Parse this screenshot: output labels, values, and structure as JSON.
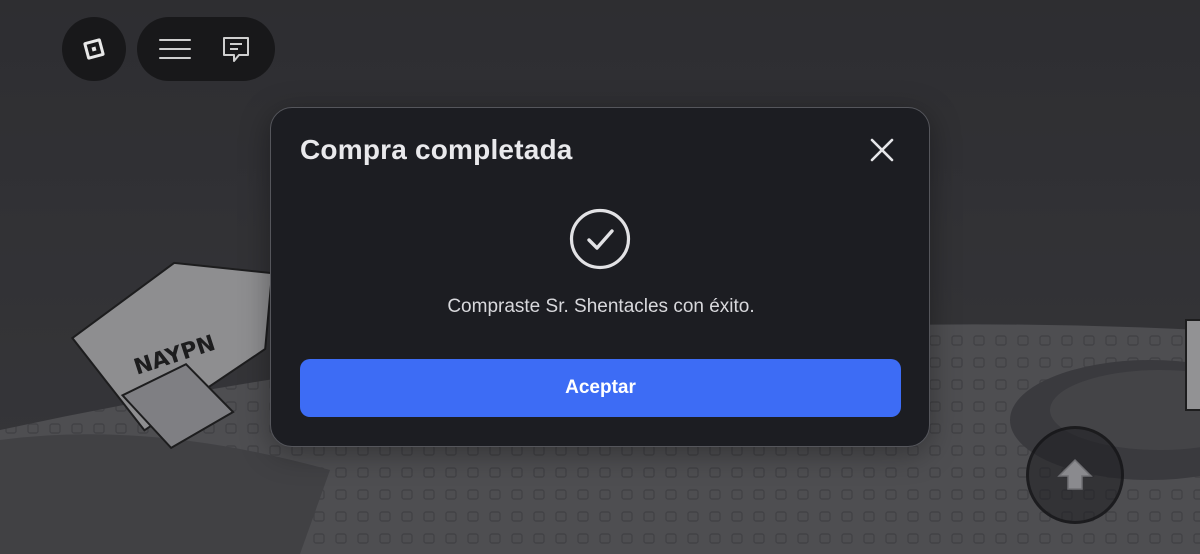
{
  "hud": {
    "logo_icon": "roblox-logo-icon",
    "menu_icon": "hamburger-menu-icon",
    "chat_icon": "chat-icon",
    "jump_icon": "jump-arrow-icon"
  },
  "dialog": {
    "title": "Compra completada",
    "close_icon": "close-icon",
    "status_icon": "checkmark-circle-icon",
    "message": "Compraste Sr. Shentacles con éxito.",
    "accept_label": "Aceptar"
  },
  "colors": {
    "dialog_bg": "#1c1d22",
    "accent": "#3d6cf5",
    "text": "#e9e9ec"
  }
}
